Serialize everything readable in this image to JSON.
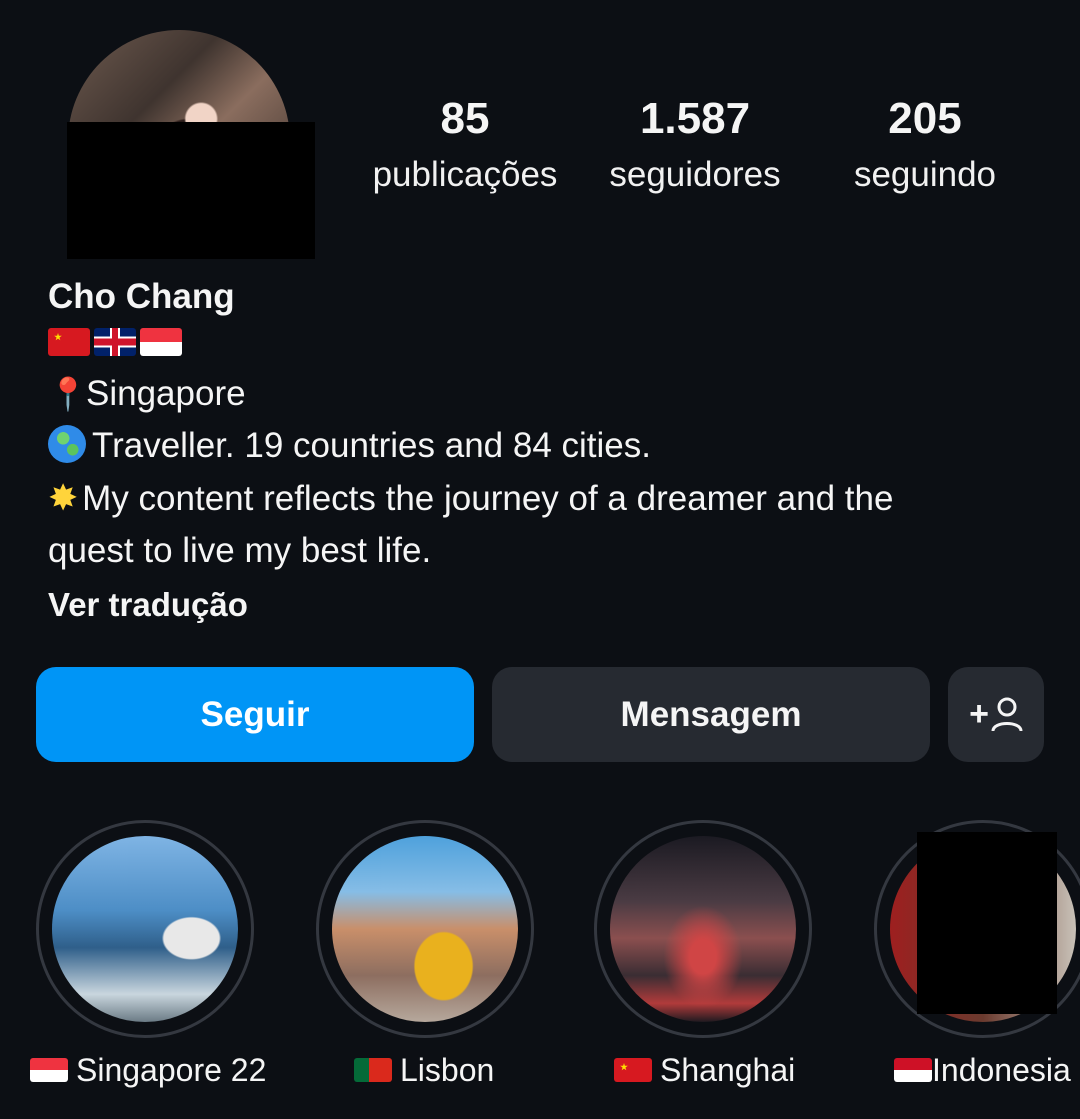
{
  "stats": {
    "posts": {
      "value": "85",
      "label": "publicações"
    },
    "followers": {
      "value": "1.587",
      "label": "seguidores"
    },
    "following": {
      "value": "205",
      "label": "seguindo"
    }
  },
  "bio": {
    "name": "Cho Chang",
    "flags": [
      "china-flag",
      "uk-flag",
      "singapore-flag"
    ],
    "location": "Singapore",
    "traveller": "Traveller. 19 countries and 84 cities.",
    "content_line1": "My content reflects the journey of a dreamer and the",
    "content_line2": "quest to live my best life.",
    "translate": "Ver tradução"
  },
  "actions": {
    "follow": "Seguir",
    "message": "Mensagem",
    "add_user_glyph": "+"
  },
  "highlights": [
    {
      "label": "Singapore 22",
      "flag": "singapore-flag"
    },
    {
      "label": "Lisbon",
      "flag": "portugal-flag"
    },
    {
      "label": "Shanghai",
      "flag": "china-flag"
    },
    {
      "label": "Indonesia",
      "flag": "indonesia-flag"
    }
  ],
  "colors": {
    "background": "#0c0f14",
    "follow_button": "#0095f6",
    "secondary_button": "#262a31"
  }
}
